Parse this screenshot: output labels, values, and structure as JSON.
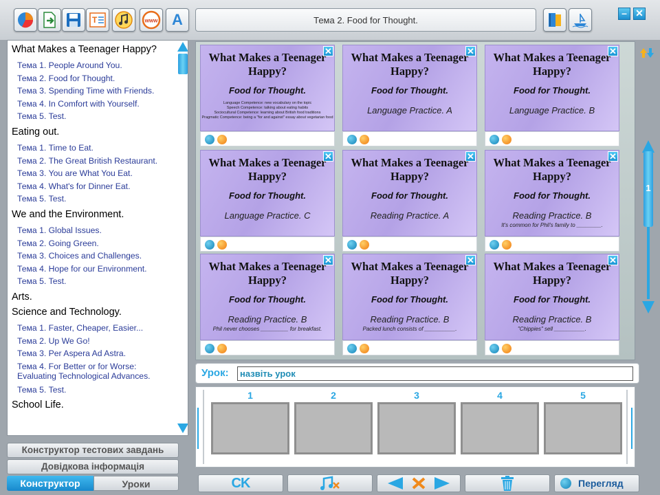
{
  "header": {
    "title": "Тема 2. Food for Thought.",
    "toolbar_a_label": "A",
    "toolbar_www_label": "www"
  },
  "sidebar": {
    "sections": [
      {
        "title": "What Makes a Teenager Happy?",
        "items": [
          "Тема 1. People Around You.",
          "Тема 2. Food for Thought.",
          "Тема 3. Spending Time with Friends.",
          "Тема 4. In Comfort with Yourself.",
          "Тема 5. Test."
        ]
      },
      {
        "title": "Eating out.",
        "items": [
          "Тема 1. Time to Eat.",
          "Тема 2. The Great British Restaurant.",
          "Тема 3. You are What You Eat.",
          "Тема 4. What's for Dinner Eat.",
          "Тема 5. Test."
        ]
      },
      {
        "title": "We and the Environment.",
        "items": [
          "Тема 1. Global Issues.",
          "Тема 2. Going Green.",
          "Тема 3. Choices and Challenges.",
          "Тема 4. Hope for our Environment.",
          "Тема 5. Test."
        ]
      },
      {
        "title": "Arts.",
        "items": []
      },
      {
        "title": "Science and Technology.",
        "items": [
          "Тема 1. Faster, Cheaper, Easier...",
          "Тема 2. Up We Go!",
          "Тема 3. Per Aspera Ad Astra.",
          "Тема 4. For Better or for Worse: Evaluating Technological Advances.",
          "Тема 5. Test."
        ]
      },
      {
        "title": "School Life.",
        "items": []
      }
    ]
  },
  "left_buttons": {
    "test_constructor": "Конструктор тестових завдань",
    "help": "Довідкова інформація",
    "tab_constructor": "Конструктор",
    "tab_lessons": "Уроки"
  },
  "slides": [
    {
      "title": "What Makes a Teenager Happy?",
      "subtitle": "Food for Thought.",
      "caption": "",
      "note": "",
      "small": [
        "Language Competence: new vocabulary on the topic",
        "Speech Competence: talking about eating habits",
        "Sociocultural Competence: learning about British food traditions",
        "Pragmatic Competence: being a \"for and against\" essay about vegetarian food"
      ]
    },
    {
      "title": "What Makes a Teenager Happy?",
      "subtitle": "Food for Thought.",
      "caption": "Language Practice. A",
      "note": "",
      "small": []
    },
    {
      "title": "What Makes a Teenager Happy?",
      "subtitle": "Food for Thought.",
      "caption": "Language Practice. B",
      "note": "",
      "small": []
    },
    {
      "title": "What Makes a Teenager Happy?",
      "subtitle": "Food for Thought.",
      "caption": "Language Practice. C",
      "note": "",
      "small": []
    },
    {
      "title": "What Makes a Teenager Happy?",
      "subtitle": "Food for Thought.",
      "caption": "Reading Practice. A",
      "note": "",
      "small": []
    },
    {
      "title": "What Makes a Teenager Happy?",
      "subtitle": "Food for Thought.",
      "caption": "Reading Practice. B",
      "note": "It's common for Phil's family to ________.",
      "small": []
    },
    {
      "title": "What Makes a Teenager Happy?",
      "subtitle": "Food for Thought.",
      "caption": "Reading Practice. B",
      "note": "Phil never chooses _________ for breakfast.",
      "small": []
    },
    {
      "title": "What Makes a Teenager Happy?",
      "subtitle": "Food for Thought.",
      "caption": "Reading Practice. B",
      "note": "Packed lunch consists of __________.",
      "small": []
    },
    {
      "title": "What Makes a Teenager Happy?",
      "subtitle": "Food for Thought.",
      "caption": "Reading Practice. B",
      "note": "\"Chippies\" sell __________.",
      "small": []
    }
  ],
  "grid_scroll": {
    "page": "1"
  },
  "lesson": {
    "label": "Урок:",
    "value": "назвіть урок"
  },
  "filmstrip": {
    "slots": [
      "1",
      "2",
      "3",
      "4",
      "5"
    ]
  },
  "bottom": {
    "ck_label": "CK",
    "preview_label": "Перегляд"
  },
  "colors": {
    "accent": "#2aa7e3",
    "slide": "#c5b4ef",
    "link": "#2a3b98"
  }
}
